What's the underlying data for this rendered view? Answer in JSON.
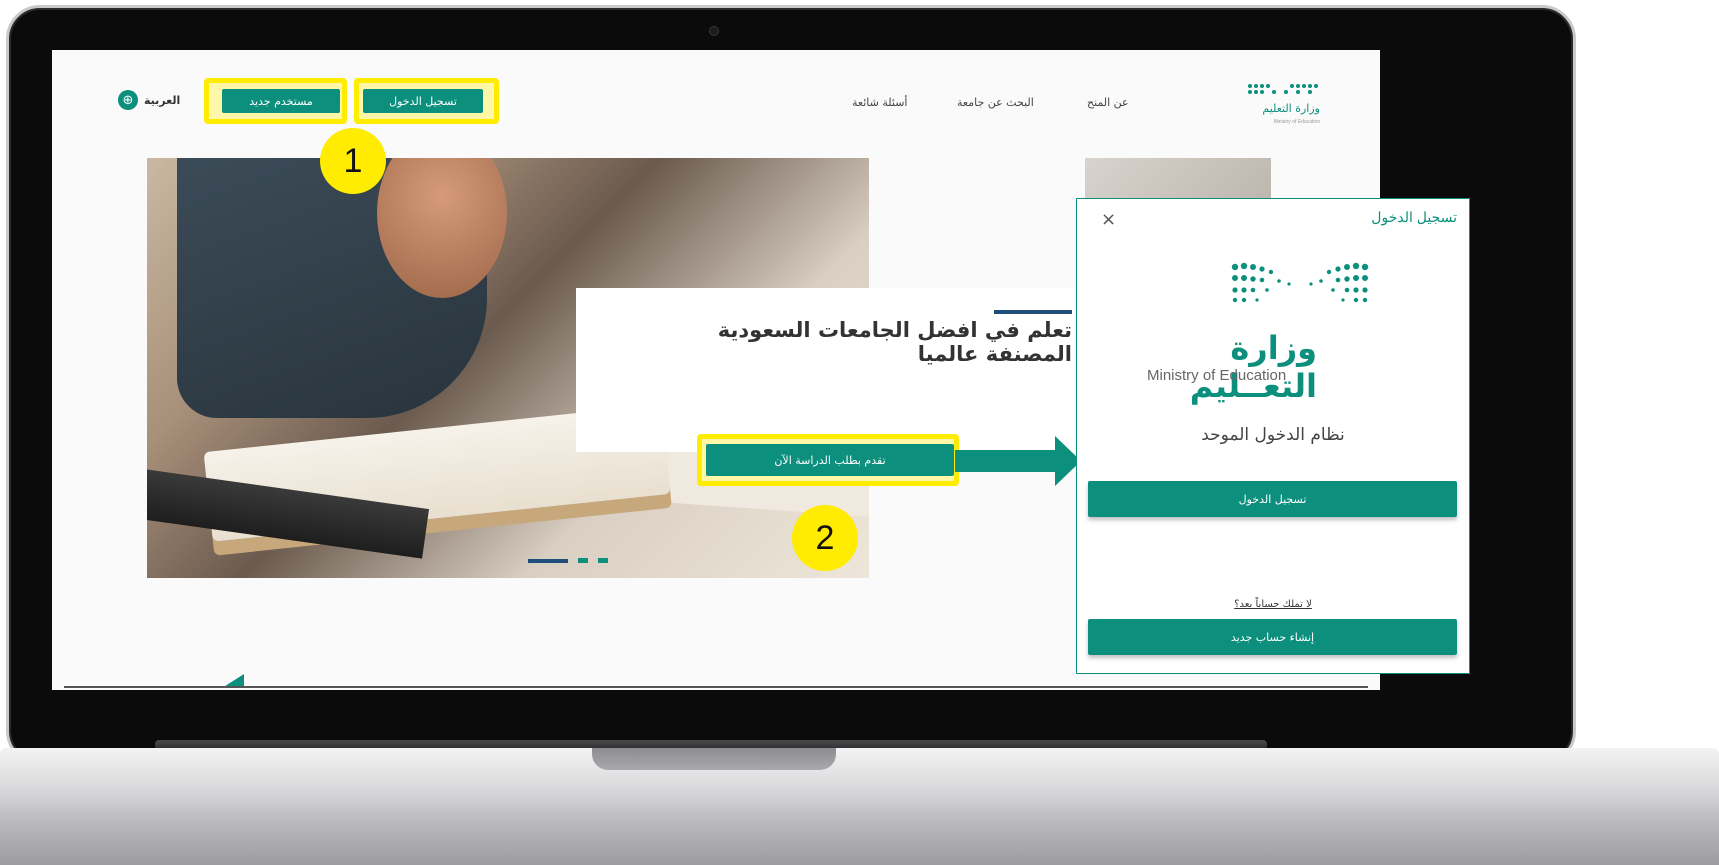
{
  "nav": {
    "language": "العربية",
    "new_user": "مستخدم جديد",
    "login": "تسجيل الدخول",
    "links": [
      "أسئلة شائعة",
      "البحث عن جامعة",
      "عن المنح"
    ],
    "logo_ar": "وزارة التعليم",
    "logo_en": "Ministry of Education"
  },
  "hero": {
    "title_line1": "تعلم في افضل الجامعات السعودية",
    "title_line2": "المصنفة عالميا",
    "cta": "تقدم بطلب الدراسة الآن",
    "slides": 3,
    "active_slide": 1
  },
  "steps": [
    "1",
    "2"
  ],
  "modal": {
    "title": "تسجيل الدخول",
    "close": "×",
    "ministry_ar": "وزارة التعــليم",
    "ministry_en": "Ministry of Education",
    "sso_title": "نظام الدخول الموحد",
    "login_button": "تسجيل الدخول",
    "no_account": "لا تملك حساباً بعد؟",
    "create_account_button": "إنشاء حساب جديد"
  },
  "colors": {
    "primary": "#0c8f7d",
    "accent_navy": "#1f4e79",
    "highlight": "#ffec00"
  },
  "icons": [
    "globe-icon",
    "close-icon",
    "arrow-right-icon",
    "ministry-logo-icon"
  ]
}
